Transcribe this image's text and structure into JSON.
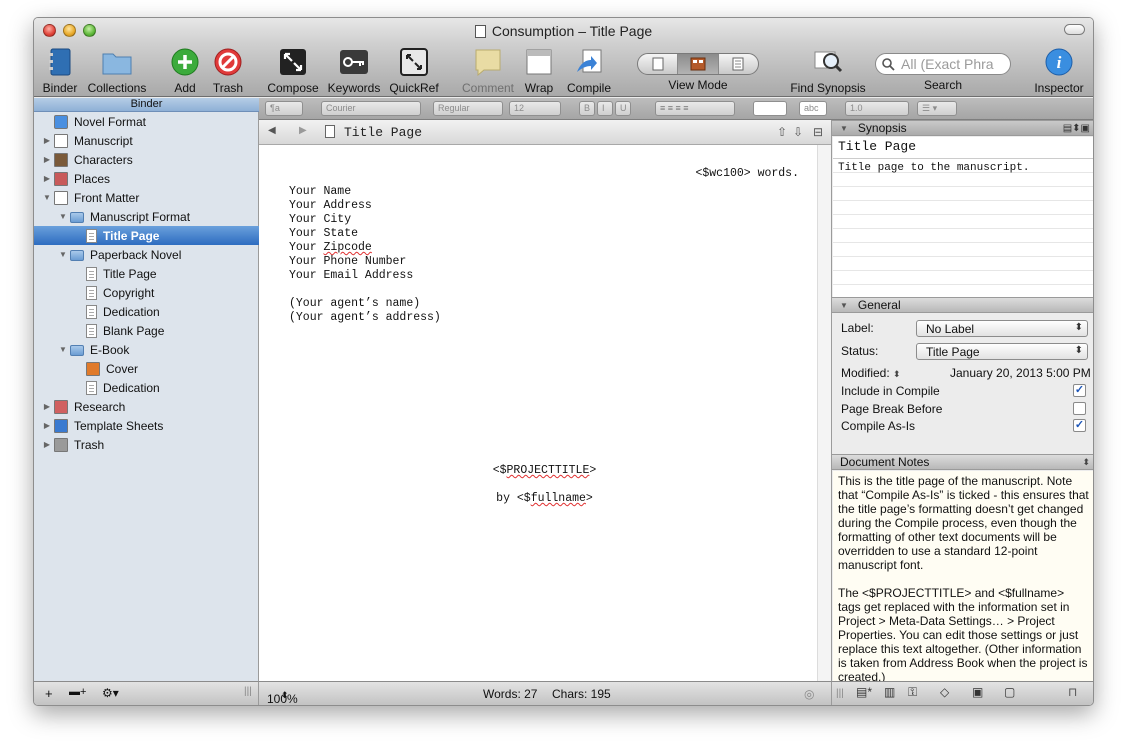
{
  "window": {
    "title": "Consumption – Title Page"
  },
  "toolbar": {
    "binder": "Binder",
    "collections": "Collections",
    "add": "Add",
    "trash": "Trash",
    "compose": "Compose",
    "keywords": "Keywords",
    "quickref": "QuickRef",
    "comment": "Comment",
    "wrap": "Wrap",
    "compile": "Compile",
    "view_mode": "View Mode",
    "find_synopsis": "Find Synopsis",
    "search_label": "Search",
    "search_placeholder": "All (Exact Phra",
    "inspector": "Inspector"
  },
  "formatbar": {
    "style": "¶a",
    "font": "Courier",
    "weight": "Regular",
    "size": "12",
    "bold": "B",
    "italic": "I",
    "underline": "U",
    "highlight": "abc",
    "line_spacing": "1.0"
  },
  "binder": {
    "header": "Binder",
    "items": [
      {
        "label": "Novel Format",
        "icon": "warning-icon",
        "indent": 0,
        "disclosure": ""
      },
      {
        "label": "Manuscript",
        "icon": "manuscript-icon",
        "indent": 0,
        "disclosure": "▶"
      },
      {
        "label": "Characters",
        "icon": "characters-icon",
        "indent": 0,
        "disclosure": "▶"
      },
      {
        "label": "Places",
        "icon": "places-icon",
        "indent": 0,
        "disclosure": "▶"
      },
      {
        "label": "Front Matter",
        "icon": "front-matter-icon",
        "indent": 0,
        "disclosure": "▼"
      },
      {
        "label": "Manuscript Format",
        "icon": "folder-icon",
        "indent": 1,
        "disclosure": "▼"
      },
      {
        "label": "Title Page",
        "icon": "document-icon",
        "indent": 2,
        "disclosure": "",
        "selected": true
      },
      {
        "label": "Paperback Novel",
        "icon": "folder-icon",
        "indent": 1,
        "disclosure": "▼"
      },
      {
        "label": "Title Page",
        "icon": "document-icon",
        "indent": 2,
        "disclosure": ""
      },
      {
        "label": "Copyright",
        "icon": "document-icon",
        "indent": 2,
        "disclosure": ""
      },
      {
        "label": "Dedication",
        "icon": "document-icon",
        "indent": 2,
        "disclosure": ""
      },
      {
        "label": "Blank Page",
        "icon": "document-icon",
        "indent": 2,
        "disclosure": ""
      },
      {
        "label": "E-Book",
        "icon": "folder-icon",
        "indent": 1,
        "disclosure": "▼"
      },
      {
        "label": "Cover",
        "icon": "image-icon",
        "indent": 2,
        "disclosure": ""
      },
      {
        "label": "Dedication",
        "icon": "document-icon",
        "indent": 2,
        "disclosure": ""
      },
      {
        "label": "Research",
        "icon": "research-icon",
        "indent": 0,
        "disclosure": "▶"
      },
      {
        "label": "Template Sheets",
        "icon": "template-icon",
        "indent": 0,
        "disclosure": "▶"
      },
      {
        "label": "Trash",
        "icon": "trash-icon",
        "indent": 0,
        "disclosure": "▶"
      }
    ]
  },
  "editor": {
    "doc_title": "Title Page",
    "lines": [
      "Your Name",
      "Your Address",
      "Your City",
      "Your State",
      "Your Zipcode",
      "Your Phone Number",
      "Your Email Address",
      "",
      "(Your agent’s name)",
      "(Your agent’s address)"
    ],
    "word_count_tag": "<$wc100> words.",
    "project_title_tag": "<$PROJECTTITLE>",
    "byline": "by <$fullname>"
  },
  "status": {
    "zoom": "100%",
    "words": "Words: 27",
    "chars": "Chars: 195"
  },
  "inspector": {
    "synopsis_header": "Synopsis",
    "synopsis_title": "Title Page",
    "synopsis_text": "Title page to the manuscript.",
    "general_header": "General",
    "label_caption": "Label:",
    "label_value": "No Label",
    "status_caption": "Status:",
    "status_value": "Title Page",
    "modified_caption": "Modified:",
    "modified_value": "January 20, 2013 5:00 PM",
    "include_compile": "Include in Compile",
    "include_compile_checked": true,
    "page_break": "Page Break Before",
    "page_break_checked": false,
    "compile_as_is": "Compile As-Is",
    "compile_as_is_checked": true,
    "notes_header": "Document Notes",
    "notes_p1": "This is the title page of the manuscript. Note that “Compile As-Is” is ticked - this ensures that the title page’s formatting doesn’t get changed during the Compile process, even though the formatting of other text documents will be overridden to use a standard 12-point manuscript font.",
    "notes_p2": "The <$PROJECTTITLE> and <$fullname> tags get replaced with the information set in Project > Meta-Data Settings… > Project Properties. You can edit those settings or just replace this text altogether. (Other information is taken from Address Book when the project is created.)"
  }
}
